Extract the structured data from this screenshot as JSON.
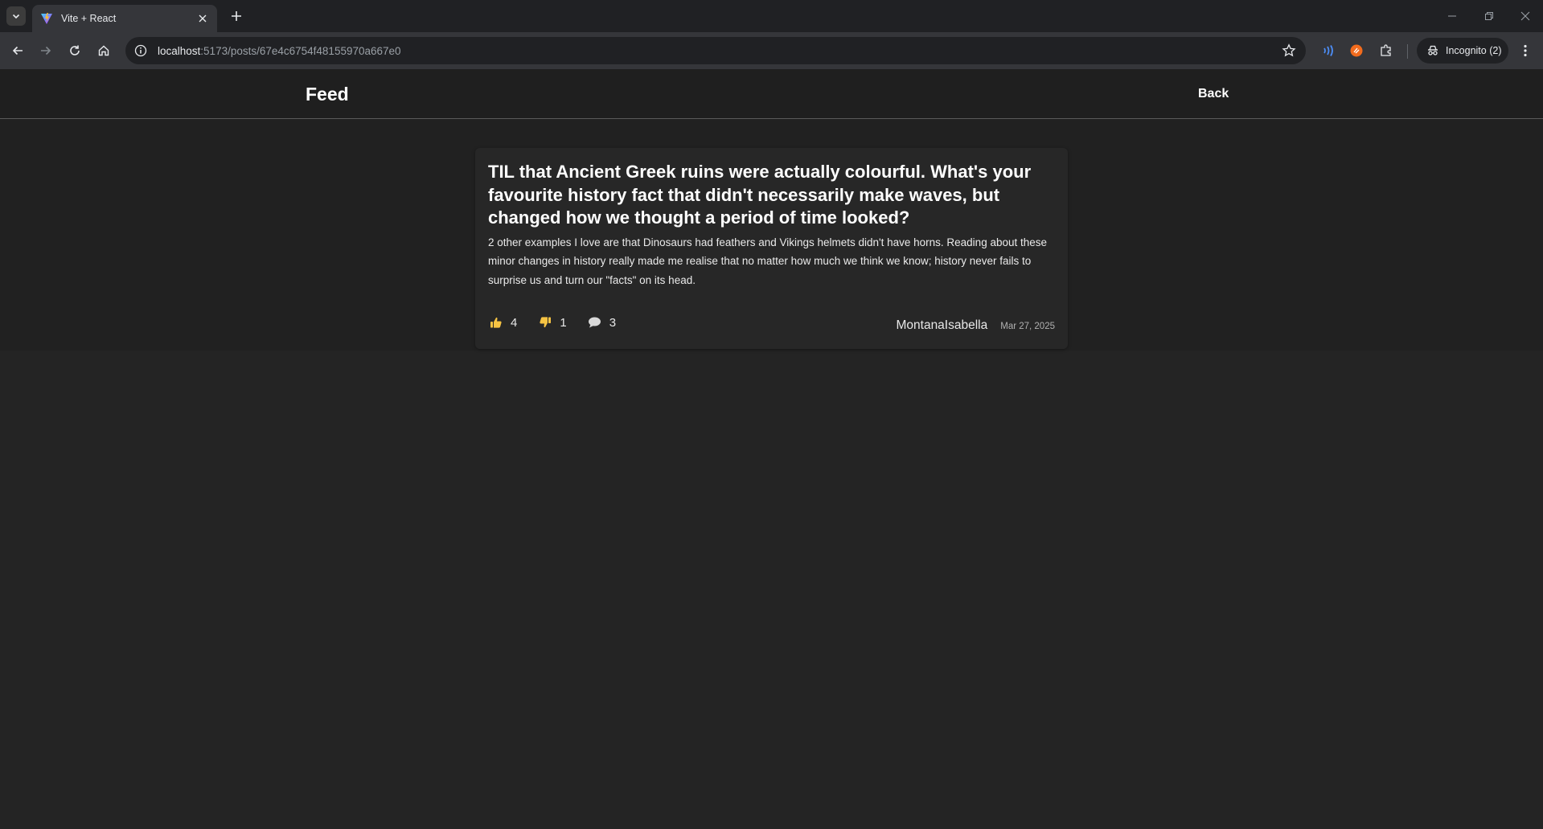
{
  "browser": {
    "tab": {
      "title": "Vite + React"
    },
    "url": {
      "host": "localhost",
      "path": ":5173/posts/67e4c6754f48155970a667e0"
    },
    "incognito_label": "Incognito (2)",
    "colors": {
      "chrome_bg": "#202124",
      "toolbar_bg": "#35363a",
      "ext_blue": "#4c8df6",
      "ext_orange": "#f26b1d"
    }
  },
  "header": {
    "brand": "Feed",
    "back_label": "Back"
  },
  "post": {
    "title": "TIL that Ancient Greek ruins were actually colourful. What's your favourite history fact that didn't necessarily make waves, but changed how we thought a period of time looked?",
    "body": "2 other examples I love are that Dinosaurs had feathers and Vikings helmets didn't have horns. Reading about these minor changes in history really made me realise that no matter how much we think we know; history never fails to surprise us and turn our \"facts\" on its head.",
    "likes": "4",
    "dislikes": "1",
    "comments": "3",
    "author": "MontanaIsabella",
    "date": "Mar 27, 2025",
    "icons": {
      "like": "thumbs-up-icon",
      "dislike": "thumbs-down-icon",
      "comment": "comment-icon"
    },
    "colors": {
      "icon_yellow": "#f6c343",
      "comment_icon": "#d9d9d9"
    }
  }
}
